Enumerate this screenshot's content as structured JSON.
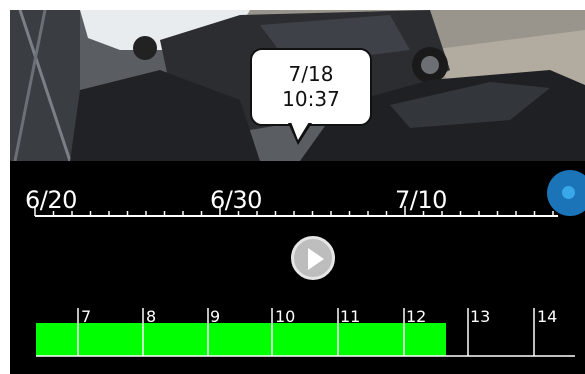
{
  "video": {
    "timestamp_date": "7/18",
    "timestamp_time": "10:37"
  },
  "date_timeline": {
    "labels": [
      "6/20",
      "6/30",
      "7/10"
    ]
  },
  "player": {
    "play_icon": "play-icon"
  },
  "hour_timeline": {
    "hours": [
      "7",
      "8",
      "9",
      "10",
      "11",
      "12",
      "13",
      "14"
    ],
    "recording_color": "#00ff00",
    "recorded_fraction_end": 0.76
  },
  "colors": {
    "background": "#000000",
    "accent": "#1b73b8",
    "recording": "#00ff00"
  }
}
